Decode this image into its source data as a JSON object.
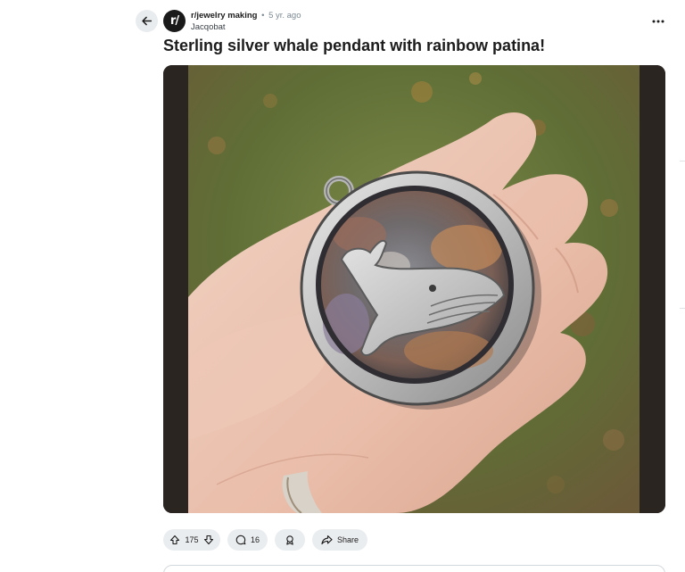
{
  "post": {
    "subreddit": "r/jewelry making",
    "separator": "•",
    "age": "5 yr. ago",
    "author": "Jacqobat",
    "title": "Sterling silver whale pendant with rainbow patina!",
    "avatar_glyph": "r/"
  },
  "actions": {
    "upvotes": "175",
    "comments": "16",
    "share_label": "Share"
  },
  "icons": {
    "back": "arrow-left-icon",
    "more": "more-horizontal-icon",
    "upvote": "arrow-up-icon",
    "downvote": "arrow-down-icon",
    "comment": "speech-bubble-icon",
    "award": "award-icon",
    "share": "share-arrow-icon"
  },
  "colors": {
    "pill_bg": "#eaedef",
    "avatar_bg": "#1a1a1b",
    "meta_gray": "#7c8a94"
  }
}
